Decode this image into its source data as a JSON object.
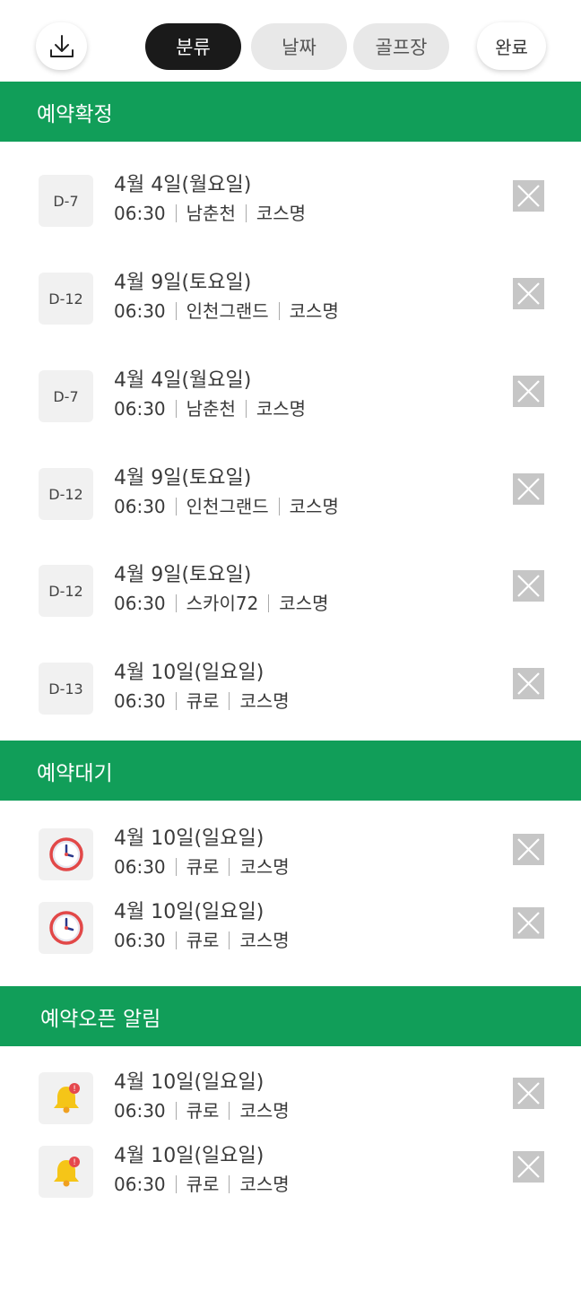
{
  "toolbar": {
    "download_icon": "download-icon",
    "tabs": [
      {
        "label": "분류",
        "active": true
      },
      {
        "label": "날짜",
        "active": false
      },
      {
        "label": "골프장",
        "active": false
      }
    ],
    "done_label": "완료"
  },
  "colors": {
    "section_bg": "#119e59",
    "active_tab_bg": "#1a1a1a",
    "tab_bg": "#e8e8e8",
    "close_bg": "#c6c6c6",
    "badge_bg": "#f1f1f1"
  },
  "sections": [
    {
      "title": "예약확정",
      "items": [
        {
          "badge": "D-7",
          "date": "4월 4일(월요일)",
          "time": "06:30",
          "club": "남춘천",
          "course": "코스명"
        },
        {
          "badge": "D-12",
          "date": "4월 9일(토요일)",
          "time": "06:30",
          "club": "인천그랜드",
          "course": "코스명"
        },
        {
          "badge": "D-7",
          "date": "4월 4일(월요일)",
          "time": "06:30",
          "club": "남춘천",
          "course": "코스명"
        },
        {
          "badge": "D-12",
          "date": "4월 9일(토요일)",
          "time": "06:30",
          "club": "인천그랜드",
          "course": "코스명"
        },
        {
          "badge": "D-12",
          "date": "4월 9일(토요일)",
          "time": "06:30",
          "club": "스카이72",
          "course": "코스명"
        },
        {
          "badge": "D-13",
          "date": "4월 10일(일요일)",
          "time": "06:30",
          "club": "큐로",
          "course": "코스명"
        }
      ]
    },
    {
      "title": "예약대기",
      "items": [
        {
          "icon": "alarm-clock-icon",
          "date": "4월 10일(일요일)",
          "time": "06:30",
          "club": "큐로",
          "course": "코스명"
        },
        {
          "icon": "alarm-clock-icon",
          "date": "4월 10일(일요일)",
          "time": "06:30",
          "club": "큐로",
          "course": "코스명"
        }
      ]
    },
    {
      "title": "예약오픈 알림",
      "items": [
        {
          "icon": "notification-bell-icon",
          "date": "4월 10일(일요일)",
          "time": "06:30",
          "club": "큐로",
          "course": "코스명"
        },
        {
          "icon": "notification-bell-icon",
          "date": "4월 10일(일요일)",
          "time": "06:30",
          "club": "큐로",
          "course": "코스명"
        }
      ]
    }
  ]
}
